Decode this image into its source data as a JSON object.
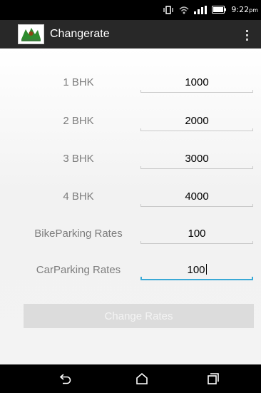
{
  "status_bar": {
    "time": "9:22",
    "time_suffix": "pm",
    "icons": [
      "vibrate-icon",
      "wifi-icon",
      "signal-icon",
      "battery-icon"
    ]
  },
  "app_bar": {
    "title": "Changerate",
    "logo_icon": "app-logo-icon",
    "menu_icon": "overflow-menu-icon"
  },
  "form": {
    "rows": [
      {
        "label": "1 BHK",
        "value": "1000"
      },
      {
        "label": "2 BHK",
        "value": "2000"
      },
      {
        "label": "3 BHK",
        "value": "3000"
      },
      {
        "label": "4 BHK",
        "value": "4000"
      },
      {
        "label": "BikeParking Rates",
        "value": "100"
      },
      {
        "label": "CarParking Rates",
        "value": "100"
      }
    ],
    "button_label": "Change Rates"
  },
  "nav_bar": {
    "icons": [
      "back-icon",
      "home-icon",
      "recent-apps-icon"
    ]
  },
  "colors": {
    "accent": "#3aa9d6",
    "app_bar": "#282828",
    "button": "#dcdcdc"
  }
}
